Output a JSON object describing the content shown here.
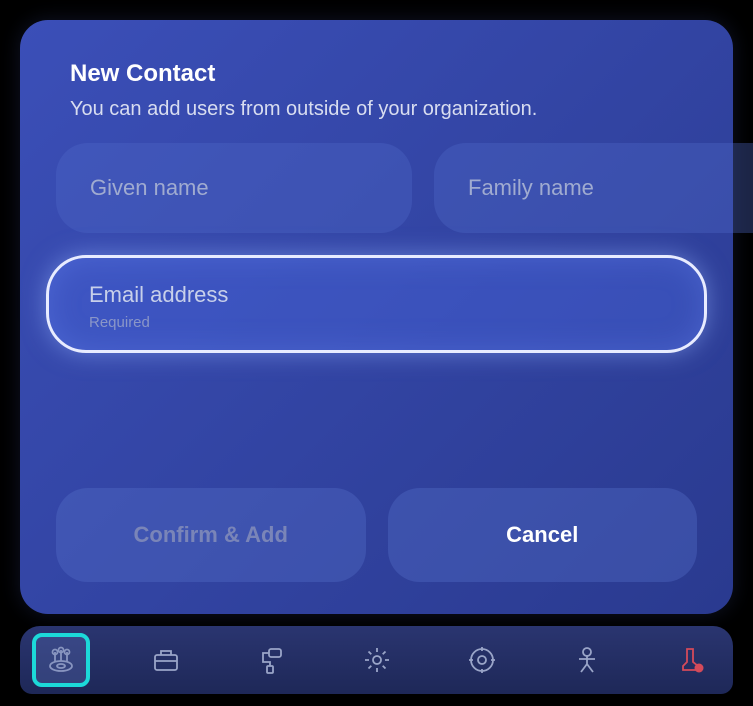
{
  "dialog": {
    "title": "New Contact",
    "subtitle": "You can add users from outside of your organization.",
    "givenNamePlaceholder": "Given name",
    "familyNamePlaceholder": "Family name",
    "emailLabel": "Email address",
    "emailRequired": "Required",
    "confirmLabel": "Confirm & Add",
    "cancelLabel": "Cancel"
  },
  "taskbar": {
    "items": [
      {
        "name": "apps",
        "active": true
      },
      {
        "name": "briefcase",
        "active": false
      },
      {
        "name": "paint-roller",
        "active": false
      },
      {
        "name": "settings",
        "active": false
      },
      {
        "name": "target",
        "active": false
      },
      {
        "name": "person",
        "active": false
      },
      {
        "name": "boot-alert",
        "active": false
      }
    ]
  }
}
